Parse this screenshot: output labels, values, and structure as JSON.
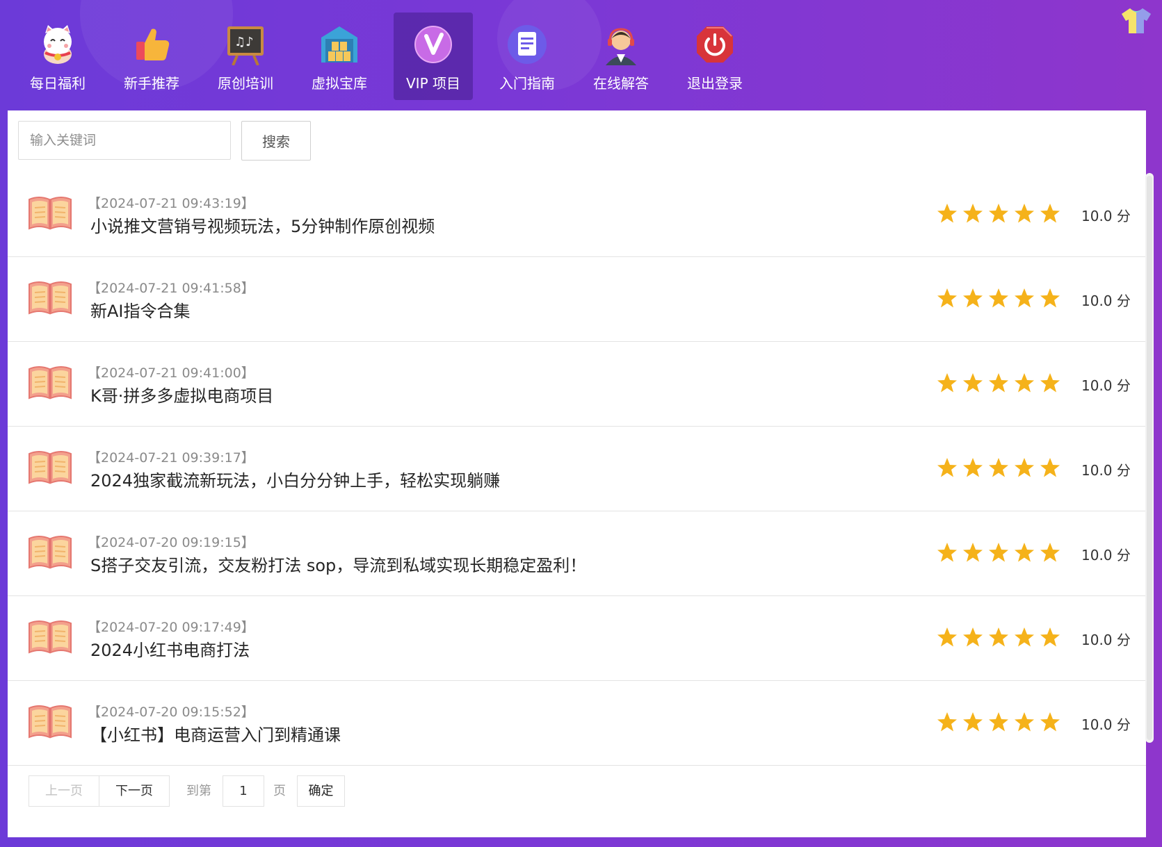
{
  "nav": {
    "items": [
      {
        "label": "每日福利",
        "icon": "lucky-cat-icon"
      },
      {
        "label": "新手推荐",
        "icon": "thumbs-up-icon"
      },
      {
        "label": "原创培训",
        "icon": "chalkboard-icon"
      },
      {
        "label": "虚拟宝库",
        "icon": "warehouse-icon"
      },
      {
        "label": "VIP 项目",
        "icon": "vip-icon",
        "active": true
      },
      {
        "label": "入门指南",
        "icon": "document-icon"
      },
      {
        "label": "在线解答",
        "icon": "support-agent-icon"
      },
      {
        "label": "退出登录",
        "icon": "power-icon"
      }
    ],
    "skin_icon": "tshirt-icon"
  },
  "search": {
    "placeholder": "输入关键词",
    "value": "",
    "button_label": "搜索"
  },
  "items": [
    {
      "date": "【2024-07-21 09:43:19】",
      "title": "小说推文营销号视频玩法，5分钟制作原创视频",
      "rating": 5,
      "score": "10.0 分"
    },
    {
      "date": "【2024-07-21 09:41:58】",
      "title": "新AI指令合集",
      "rating": 5,
      "score": "10.0 分"
    },
    {
      "date": "【2024-07-21 09:41:00】",
      "title": "K哥·拼多多虚拟电商项目",
      "rating": 5,
      "score": "10.0 分"
    },
    {
      "date": "【2024-07-21 09:39:17】",
      "title": "2024独家截流新玩法，小白分分钟上手，轻松实现躺赚",
      "rating": 5,
      "score": "10.0 分"
    },
    {
      "date": "【2024-07-20 09:19:15】",
      "title": "S搭子交友引流，交友粉打法 sop，导流到私域实现长期稳定盈利！",
      "rating": 5,
      "score": "10.0 分"
    },
    {
      "date": "【2024-07-20 09:17:49】",
      "title": "2024小红书电商打法",
      "rating": 5,
      "score": "10.0 分"
    },
    {
      "date": "【2024-07-20 09:15:52】",
      "title": "【小红书】电商运营入门到精通课",
      "rating": 5,
      "score": "10.0 分"
    }
  ],
  "pagination": {
    "prev_label": "上一页",
    "next_label": "下一页",
    "goto_label": "到第",
    "page_value": "1",
    "page_label": "页",
    "confirm_label": "确定"
  },
  "colors": {
    "header_gradient_start": "#6c3ad8",
    "header_gradient_end": "#8e36cc",
    "star": "#f5b21a",
    "book": "#f3a08c"
  }
}
